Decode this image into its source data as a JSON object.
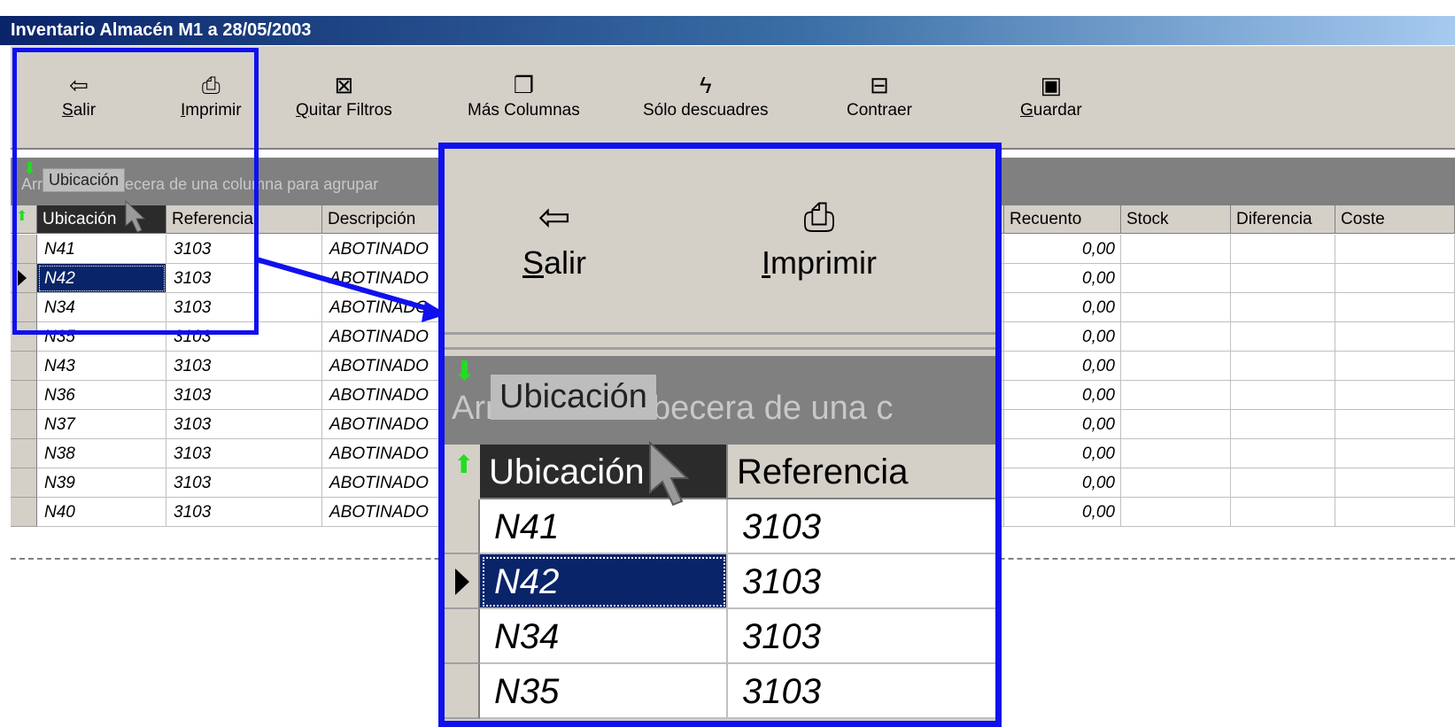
{
  "window": {
    "title": "Inventario Almacén M1 a 28/05/2003"
  },
  "toolbar": {
    "buttons": [
      {
        "key": "S",
        "rest": "alir",
        "icon": "exit-door-icon",
        "glyph": "⇦"
      },
      {
        "key": "I",
        "rest": "mprimir",
        "icon": "printer-icon",
        "glyph": "⎙"
      },
      {
        "key": "Q",
        "rest": "uitar Filtros",
        "icon": "remove-filter-icon",
        "glyph": "⊠"
      },
      {
        "key": "",
        "rest": "Más Columnas",
        "icon": "columns-icon",
        "glyph": "❐"
      },
      {
        "key": "",
        "rest": "Sólo descuadres",
        "icon": "lightning-icon",
        "glyph": "ϟ"
      },
      {
        "key": "",
        "rest": "Contraer",
        "icon": "collapse-icon",
        "glyph": "⊟"
      },
      {
        "key": "G",
        "rest": "uardar",
        "icon": "save-disk-icon",
        "glyph": "▣"
      }
    ]
  },
  "group_band": {
    "hint": "Arrastre la cabecera de una columna para agrupar",
    "drag_chip": "Ubicación"
  },
  "grid": {
    "columns": [
      "Ubicación",
      "Referencia",
      "Descripción",
      "Recuento",
      "Stock",
      "Diferencia",
      "Coste"
    ],
    "rows": [
      {
        "ubicacion": "N41",
        "referencia": "3103",
        "descripcion": "ABOTINADO",
        "recuento": "0,00"
      },
      {
        "ubicacion": "N42",
        "referencia": "3103",
        "descripcion": "ABOTINADO",
        "recuento": "0,00"
      },
      {
        "ubicacion": "N34",
        "referencia": "3103",
        "descripcion": "ABOTINADO",
        "recuento": "0,00"
      },
      {
        "ubicacion": "N35",
        "referencia": "3103",
        "descripcion": "ABOTINADO",
        "recuento": "0,00"
      },
      {
        "ubicacion": "N43",
        "referencia": "3103",
        "descripcion": "ABOTINADO",
        "recuento": "0,00"
      },
      {
        "ubicacion": "N36",
        "referencia": "3103",
        "descripcion": "ABOTINADO",
        "recuento": "0,00"
      },
      {
        "ubicacion": "N37",
        "referencia": "3103",
        "descripcion": "ABOTINADO",
        "recuento": "0,00"
      },
      {
        "ubicacion": "N38",
        "referencia": "3103",
        "descripcion": "ABOTINADO",
        "recuento": "0,00"
      },
      {
        "ubicacion": "N39",
        "referencia": "3103",
        "descripcion": "ABOTINADO",
        "recuento": "0,00"
      },
      {
        "ubicacion": "N40",
        "referencia": "3103",
        "descripcion": "ABOTINADO",
        "recuento": "0,00"
      }
    ],
    "selected_row": 1
  },
  "zoom": {
    "hint": "Arrastre la cabecera de una c",
    "drag_chip": "Ubicación",
    "columns": [
      "Ubicación",
      "Referencia"
    ],
    "rows": [
      {
        "ubicacion": "N41",
        "referencia": "3103"
      },
      {
        "ubicacion": "N42",
        "referencia": "3103"
      },
      {
        "ubicacion": "N34",
        "referencia": "3103"
      },
      {
        "ubicacion": "N35",
        "referencia": "3103"
      }
    ]
  },
  "colors": {
    "annotation": "#1010ee",
    "selection": "#0a246a",
    "arrow": "#22dd22"
  }
}
